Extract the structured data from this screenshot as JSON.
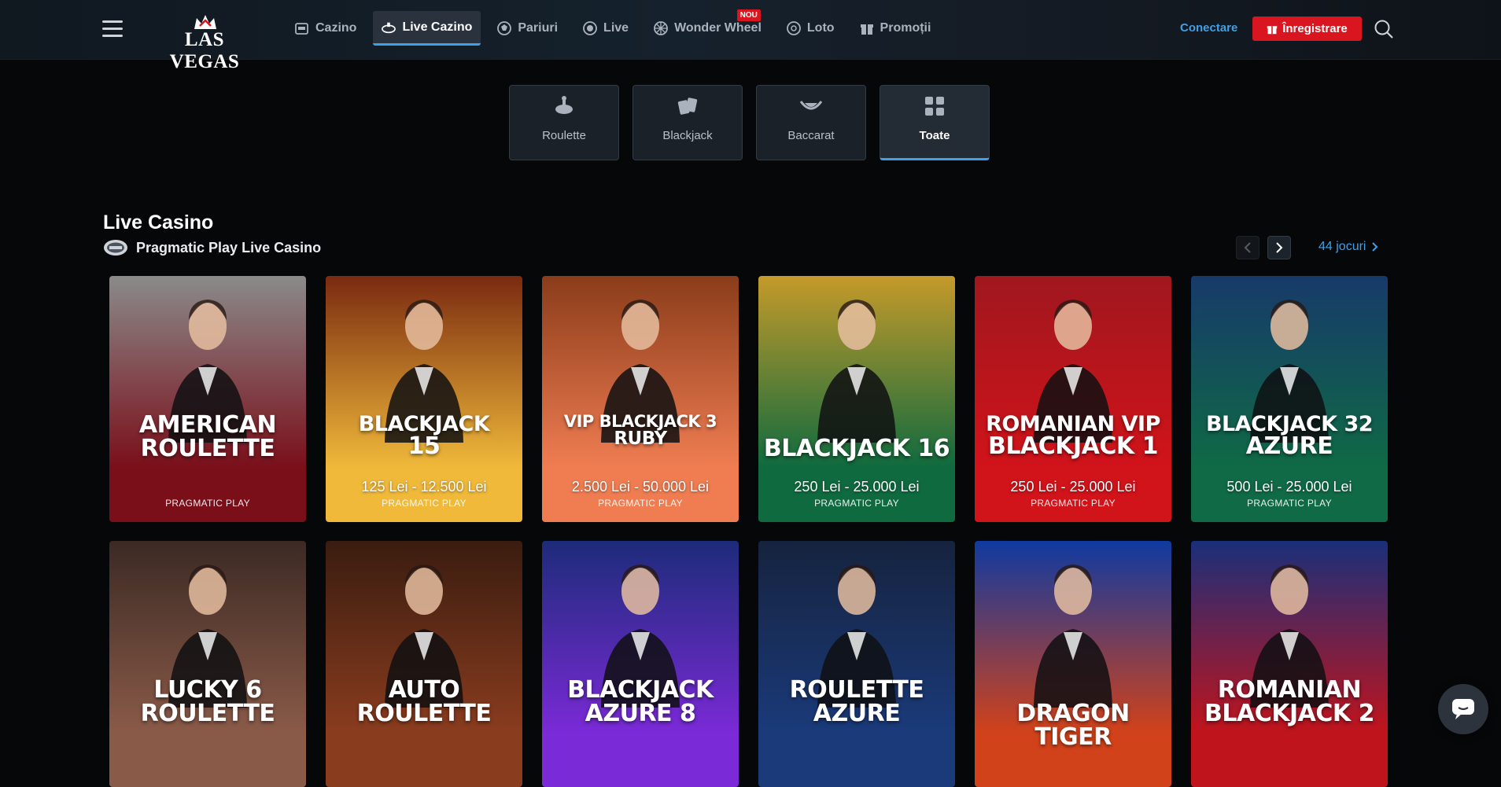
{
  "header": {
    "logo_text": "LAS VEGAS",
    "nav": [
      {
        "label": "Cazino",
        "icon": "slot-machine-icon",
        "active": false
      },
      {
        "label": "Live Cazino",
        "icon": "roulette-table-icon",
        "active": true
      },
      {
        "label": "Pariuri",
        "icon": "soccer-ball-icon",
        "active": false
      },
      {
        "label": "Live",
        "icon": "live-dot-icon",
        "active": false
      },
      {
        "label": "Wonder Wheel",
        "icon": "wheel-icon",
        "active": false,
        "badge": "NOU"
      },
      {
        "label": "Loto",
        "icon": "lottery-ball-icon",
        "active": false
      },
      {
        "label": "Promoții",
        "icon": "gift-icon",
        "active": false
      }
    ],
    "login_label": "Conectare",
    "register_label": "Înregistrare"
  },
  "categories": [
    {
      "label": "Roulette",
      "icon": "roulette-icon",
      "active": false
    },
    {
      "label": "Blackjack",
      "icon": "cards-icon",
      "active": false
    },
    {
      "label": "Baccarat",
      "icon": "baccarat-table-icon",
      "active": false
    },
    {
      "label": "Toate",
      "icon": "grid-icon",
      "active": true
    }
  ],
  "section": {
    "title": "Live Casino",
    "provider": "Pragmatic Play Live Casino",
    "count_label": "44 jocuri"
  },
  "games": [
    {
      "title": [
        "AMERICAN",
        "ROULETTE"
      ],
      "limits": "",
      "provider": "PRAGMATIC PLAY",
      "colors": [
        "#8a8a8a",
        "#7a0f1a"
      ]
    },
    {
      "title": [
        "BLACKJACK",
        "15"
      ],
      "limits": "125 Lei - 12.500 Lei",
      "provider": "PRAGMATIC PLAY",
      "colors": [
        "#7a2a10",
        "#f0b93a"
      ]
    },
    {
      "title": [
        "VIP BLACKJACK 3",
        "RUBY"
      ],
      "limits": "2.500 Lei - 50.000 Lei",
      "provider": "PRAGMATIC PLAY",
      "colors": [
        "#8a3c1a",
        "#f07d52"
      ]
    },
    {
      "title": [
        "BLACKJACK 16"
      ],
      "limits": "250 Lei - 25.000 Lei",
      "provider": "PRAGMATIC PLAY",
      "colors": [
        "#c59a2a",
        "#0f6a3f"
      ]
    },
    {
      "title": [
        "ROMANIAN VIP",
        "BLACKJACK 1"
      ],
      "limits": "250 Lei - 25.000 Lei",
      "provider": "PRAGMATIC PLAY",
      "colors": [
        "#a0171e",
        "#d1131a"
      ]
    },
    {
      "title": [
        "BLACKJACK 32",
        "AZURE"
      ],
      "limits": "500 Lei - 25.000 Lei",
      "provider": "PRAGMATIC PLAY",
      "colors": [
        "#173a6a",
        "#0f6a45"
      ]
    },
    {
      "title": [
        "LUCKY 6",
        "ROULETTE"
      ],
      "limits": "",
      "provider": "",
      "colors": [
        "#3b2a24",
        "#8a5a48"
      ]
    },
    {
      "title": [
        "AUTO",
        "ROULETTE"
      ],
      "limits": "",
      "provider": "",
      "colors": [
        "#3a1c10",
        "#8a3c1e"
      ]
    },
    {
      "title": [
        "BLACKJACK",
        "AZURE 8"
      ],
      "limits": "",
      "provider": "",
      "colors": [
        "#1d2b7a",
        "#7a2ad6"
      ]
    },
    {
      "title": [
        "ROULETTE",
        "AZURE"
      ],
      "limits": "",
      "provider": "",
      "colors": [
        "#16233e",
        "#1a3a7a"
      ]
    },
    {
      "title": [
        "DRAGON TIGER"
      ],
      "limits": "",
      "provider": "",
      "colors": [
        "#0f3aa0",
        "#d1421a"
      ]
    },
    {
      "title": [
        "ROMANIAN",
        "BLACKJACK 2"
      ],
      "limits": "",
      "provider": "",
      "colors": [
        "#1a2f7a",
        "#c0141c"
      ]
    }
  ],
  "colors": {
    "accent": "#3ea0e8",
    "brand_red": "#d9161f"
  }
}
